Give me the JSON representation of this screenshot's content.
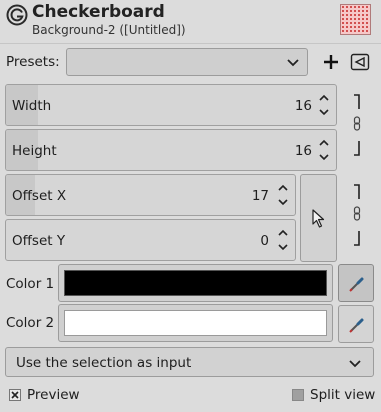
{
  "header": {
    "title": "Checkerboard",
    "subtitle": "Background-2 ([Untitled])",
    "logo_icon": "gimp-filter-icon",
    "preview_icon": "checkerboard-pattern-icon"
  },
  "presets": {
    "label": "Presets:",
    "value": "",
    "add_icon": "plus-icon",
    "menu_icon": "triangle-left-icon"
  },
  "fields": {
    "width": {
      "label": "Width",
      "value": "16",
      "fill_fraction": 0.1
    },
    "height": {
      "label": "Height",
      "value": "16",
      "fill_fraction": 0.1
    },
    "offset_x": {
      "label": "Offset X",
      "value": "17",
      "fill_fraction": 0.1
    },
    "offset_y": {
      "label": "Offset Y",
      "value": "0",
      "fill_fraction": 0.0
    }
  },
  "chain_icon": "chain-link-icon",
  "pointer_icon": "mouse-pointer-icon",
  "colors": {
    "color1": {
      "label": "Color 1",
      "value": "#000000"
    },
    "color2": {
      "label": "Color 2",
      "value": "#ffffff"
    },
    "picker_icon": "color-picker-icon"
  },
  "selection": {
    "value": "Use the selection as input"
  },
  "bottom": {
    "preview_label": "Preview",
    "preview_checked": true,
    "split_label": "Split view",
    "split_checked": false
  }
}
